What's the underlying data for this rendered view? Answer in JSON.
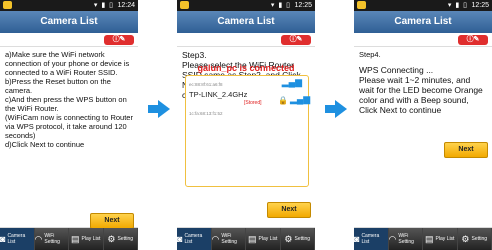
{
  "common": {
    "title": "Camera List",
    "next": "Next",
    "tabs": [
      "Camera List",
      "WiFi Setting",
      "Play List",
      "Setting"
    ]
  },
  "screens": [
    {
      "time": "12:24",
      "text": "a)Make sure the WiFi network connection of your phone or device is connected to a WiFi Router SSID.\nb)Press the Reset button on the camera.\nc)And then press the WPS button on the WiFi Router.\n(WiFiCam now is connecting to Router via WPS protocol, it take around 120 seconds)\nd)Click Next to continue"
    },
    {
      "time": "12:25",
      "text": "Step3.\nPlease select the WiFi Router SSID same as Step2. and Click Next on bottom of the screen to continue",
      "connected": "galun_pc is connected",
      "wifi": [
        {
          "name": "TP-LINK_2.4GHz",
          "mac": "1c:fa:68:13:f1:52",
          "status": "[Stored]"
        }
      ],
      "mac_top": "ec:88:8f:61:a6:f8"
    },
    {
      "time": "12:25",
      "text": "Step4.",
      "msg": "WPS Connecting ...\nPlease wait 1~2 minutes, and wait for the LED become Orange color and with a Beep sound, Click Next to continue"
    }
  ],
  "icons": {
    "help": "help-icon",
    "tab_icons": [
      "camera-icon",
      "wifi-icon",
      "playlist-icon",
      "gear-icon"
    ]
  },
  "colors": {
    "titlebar": "#2f5f95",
    "arrow": "#1e90e0",
    "accent": "#f2a900",
    "alert": "#e02020"
  }
}
